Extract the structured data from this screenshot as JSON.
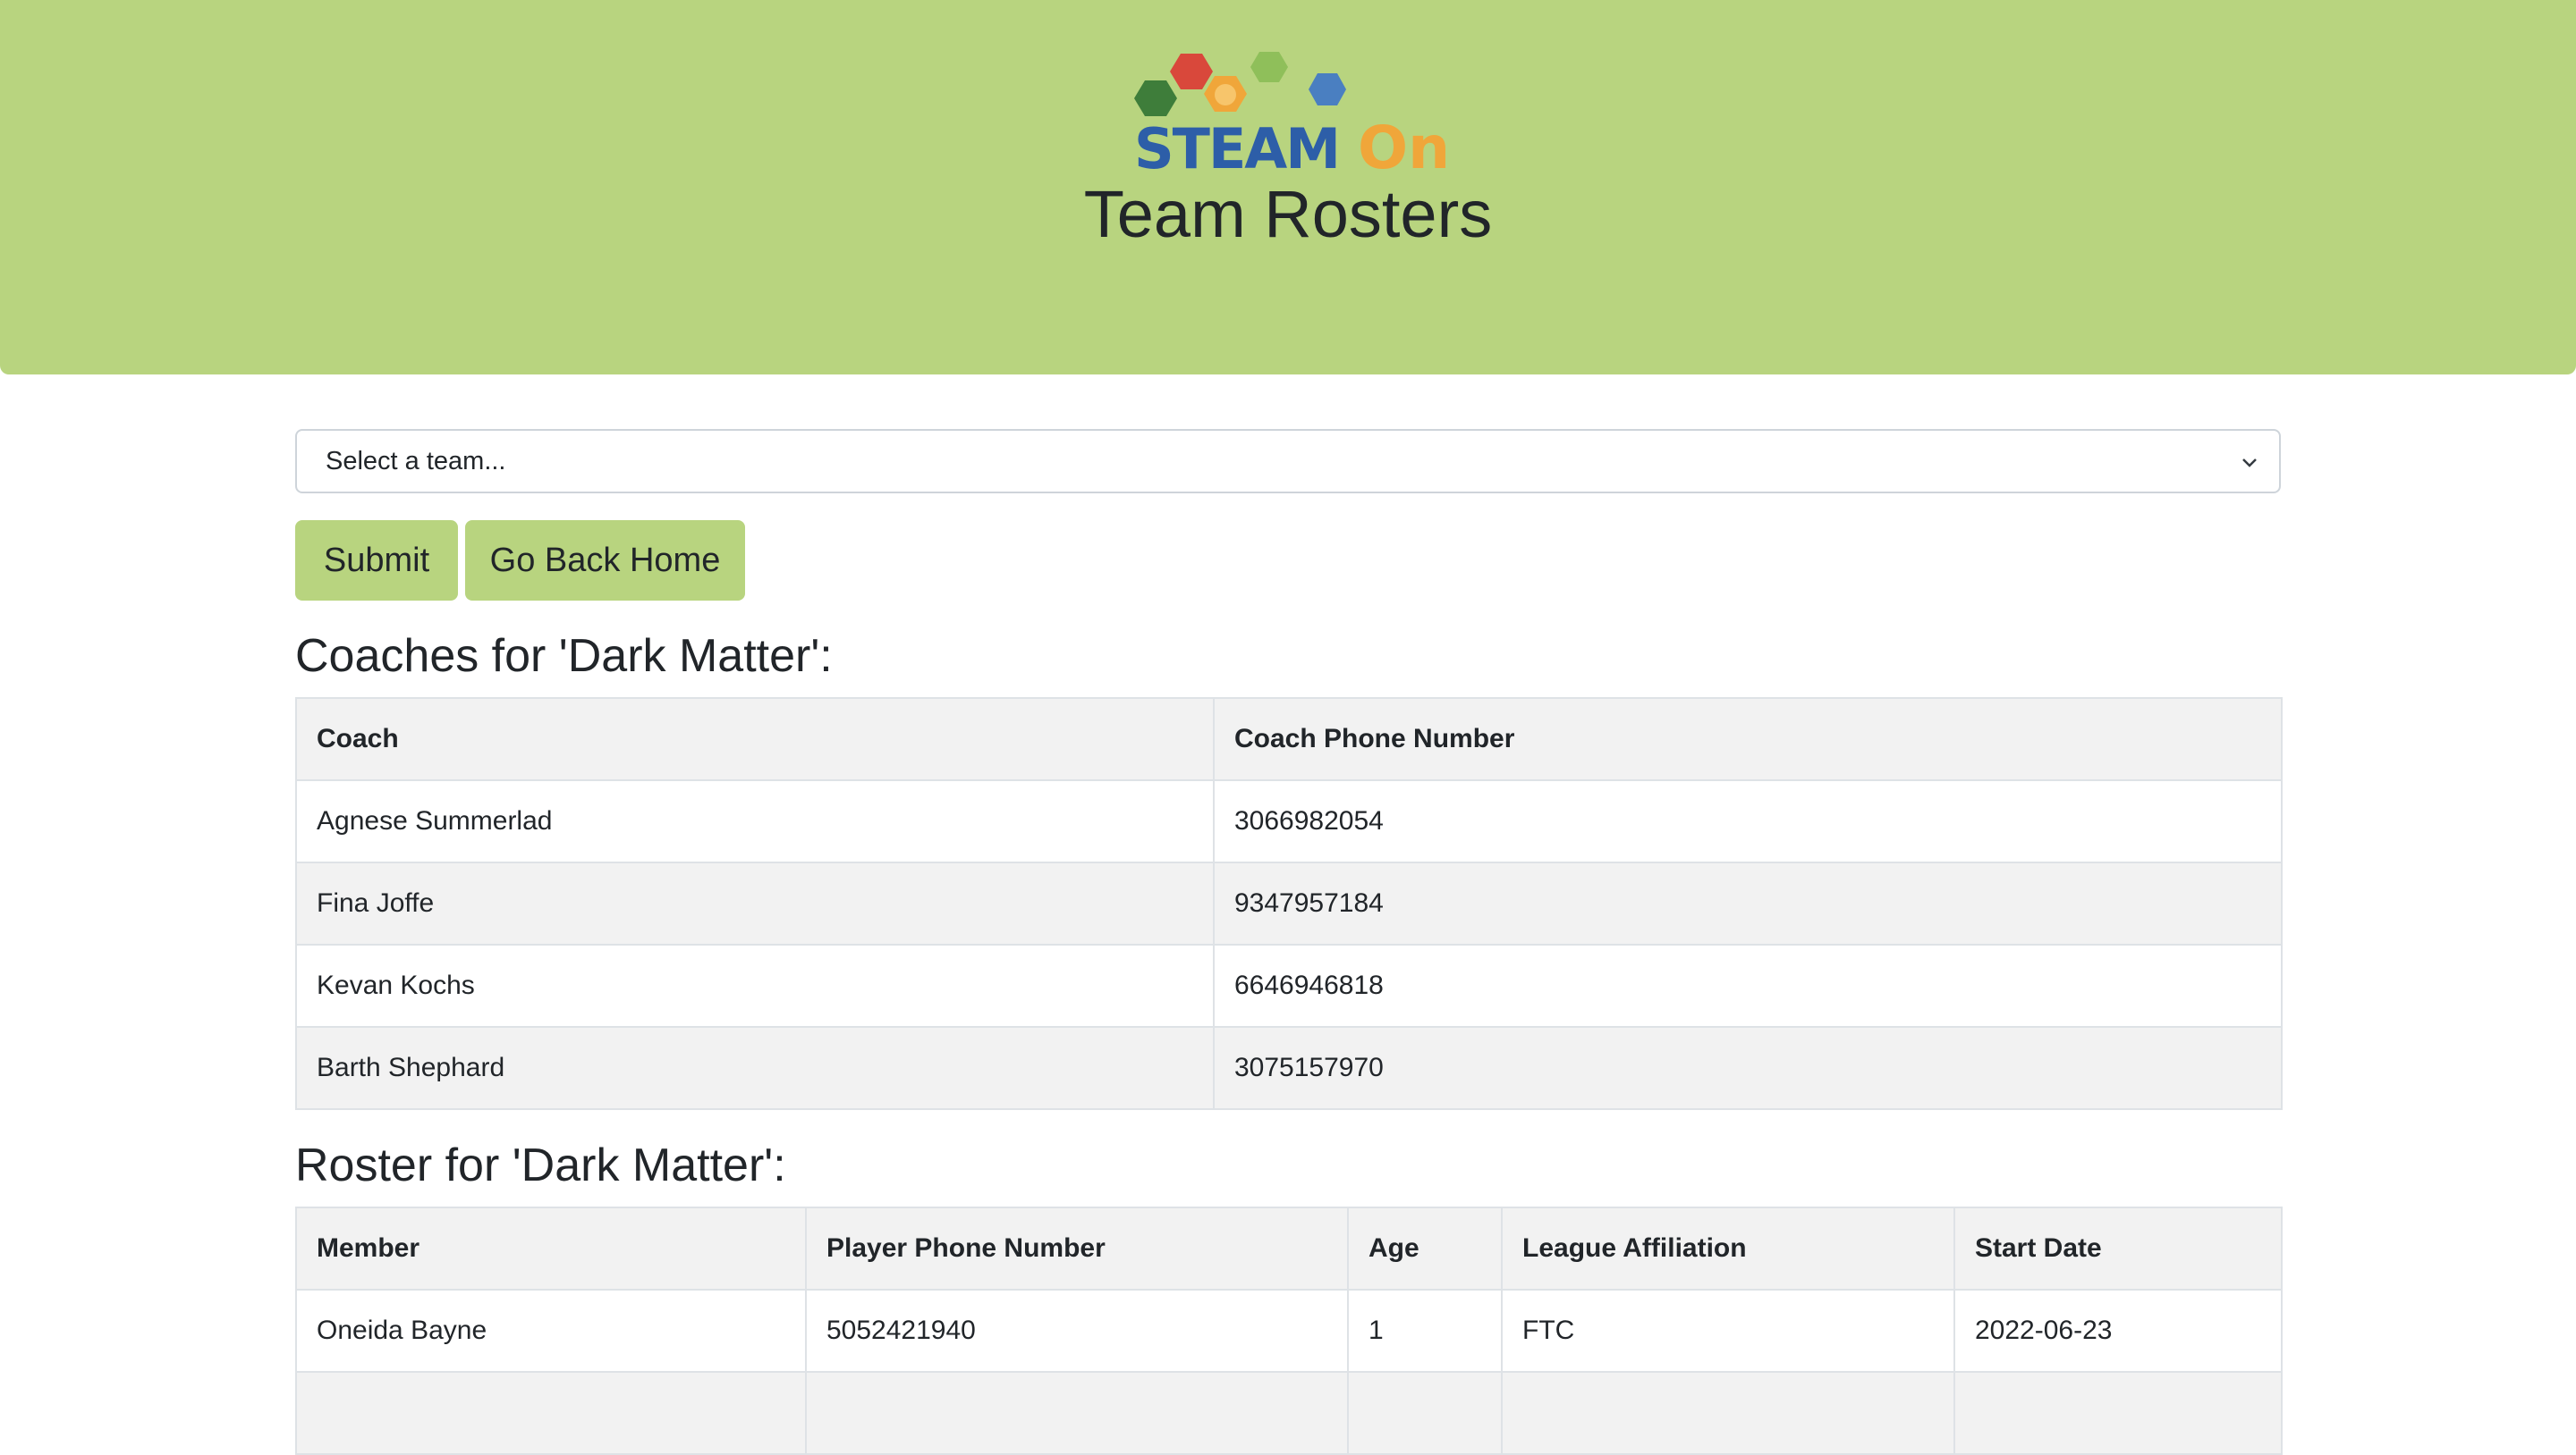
{
  "header": {
    "logo_text": "STEAM On",
    "title": "Team Rosters"
  },
  "team_select": {
    "selected": "Select a team..."
  },
  "buttons": {
    "submit": "Submit",
    "home": "Go Back Home"
  },
  "coaches": {
    "heading": "Coaches for 'Dark Matter':",
    "columns": [
      "Coach",
      "Coach Phone Number"
    ],
    "rows": [
      [
        "Agnese Summerlad",
        "3066982054"
      ],
      [
        "Fina Joffe",
        "9347957184"
      ],
      [
        "Kevan Kochs",
        "6646946818"
      ],
      [
        "Barth Shephard",
        "3075157970"
      ]
    ]
  },
  "roster": {
    "heading": "Roster for 'Dark Matter':",
    "columns": [
      "Member",
      "Player Phone Number",
      "Age",
      "League Affiliation",
      "Start Date"
    ],
    "rows": [
      [
        "Oneida Bayne",
        "5052421940",
        "1",
        "FTC",
        "2022-06-23"
      ]
    ]
  },
  "colors": {
    "accent": "#b8d47f"
  }
}
